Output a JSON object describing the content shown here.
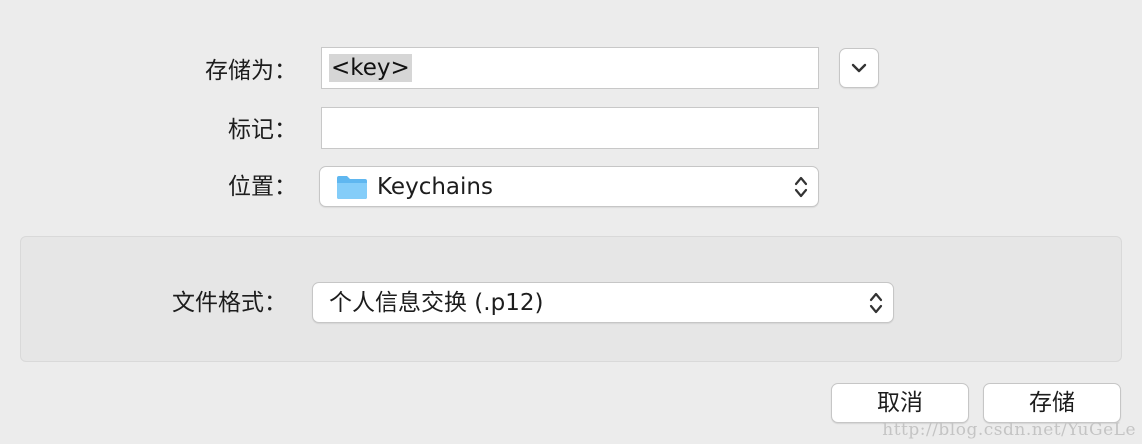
{
  "form": {
    "save_as_label": "存储为：",
    "save_as_value": "<key>",
    "tags_label": "标记：",
    "tags_value": "",
    "location_label": "位置：",
    "location_value": "Keychains"
  },
  "format": {
    "label": "文件格式：",
    "value": "个人信息交换 (.p12)"
  },
  "buttons": {
    "cancel": "取消",
    "save": "存储"
  },
  "watermark": "http://blog.csdn.net/YuGeLe",
  "icons": {
    "expand": "chevron-down-icon",
    "folder": "folder-icon",
    "popup": "up-down-chevrons-icon"
  },
  "colors": {
    "background": "#ececec",
    "folder_blue": "#6fc3f7",
    "selection": "#d6d6d6"
  }
}
